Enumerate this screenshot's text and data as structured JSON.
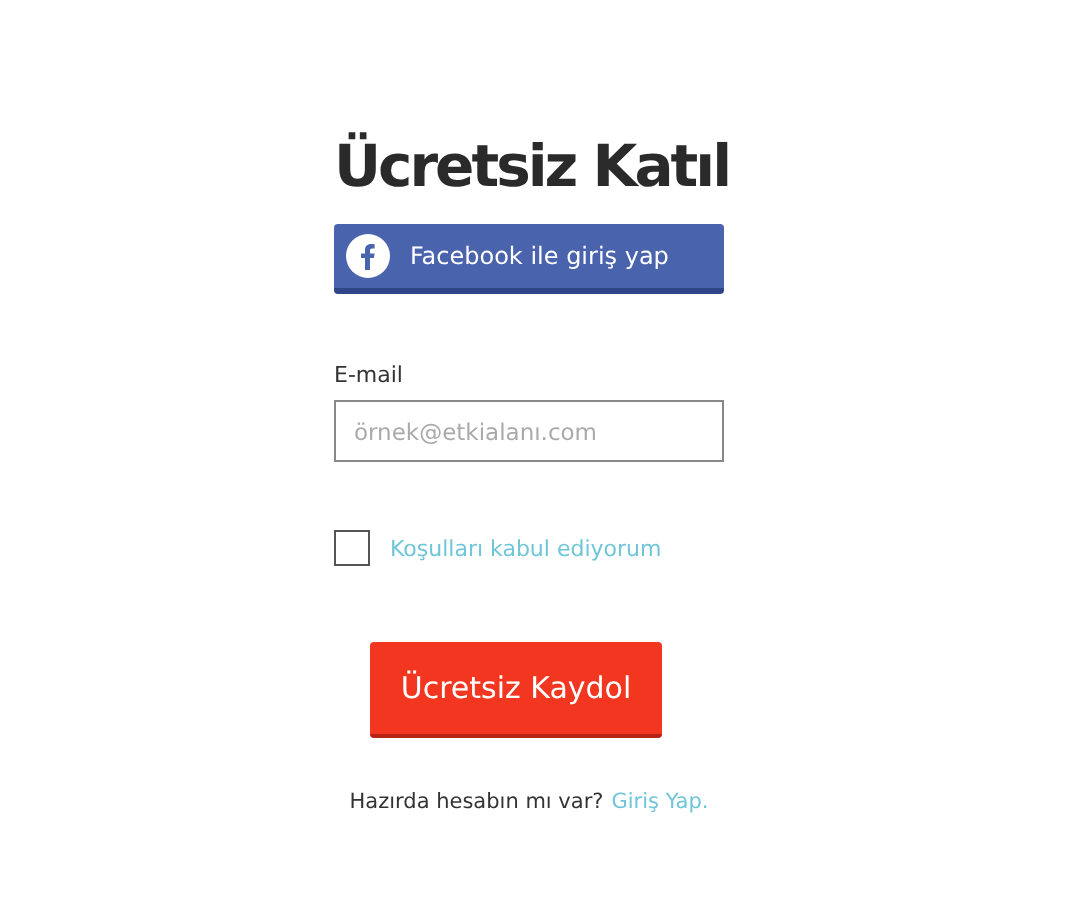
{
  "title": "Ücretsiz Katıl",
  "facebook_button": {
    "label": "Facebook ile giriş yap"
  },
  "email": {
    "label": "E-mail",
    "placeholder": "örnek@etkialanı.com"
  },
  "terms": {
    "label": "Koşulları kabul ediyorum",
    "checked": false
  },
  "submit_button": {
    "label": "Ücretsiz Kaydol"
  },
  "footer": {
    "text": "Hazırda hesabın mı var?",
    "link": "Giriş Yap."
  }
}
